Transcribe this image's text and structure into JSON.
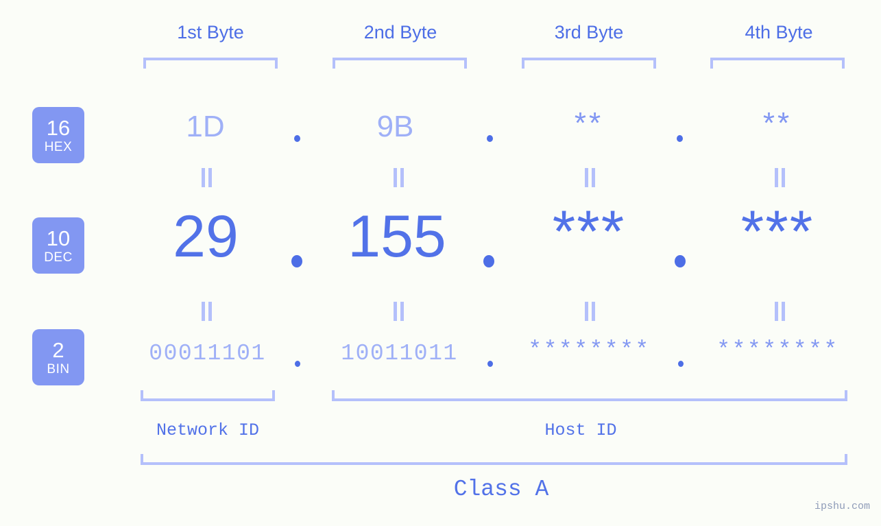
{
  "watermark": "ipshu.com",
  "byte_headers": [
    {
      "label": "1st Byte"
    },
    {
      "label": "2nd Byte"
    },
    {
      "label": "3rd Byte"
    },
    {
      "label": "4th Byte"
    }
  ],
  "radix_badges": [
    {
      "base": "16",
      "name": "HEX"
    },
    {
      "base": "10",
      "name": "DEC"
    },
    {
      "base": "2",
      "name": "BIN"
    }
  ],
  "rows": {
    "hex": {
      "base": "16",
      "name": "HEX",
      "values": [
        "1D",
        "9B",
        "**",
        "**"
      ],
      "separators": [
        ".",
        ".",
        "."
      ]
    },
    "dec": {
      "base": "10",
      "name": "DEC",
      "values": [
        "29",
        "155",
        "***",
        "***"
      ],
      "separators": [
        ".",
        ".",
        "."
      ]
    },
    "bin": {
      "base": "2",
      "name": "BIN",
      "values": [
        "00011101",
        "10011011",
        "********",
        "********"
      ],
      "separators": [
        ".",
        ".",
        "."
      ]
    }
  },
  "sections": {
    "network_id": "Network ID",
    "host_id": "Host ID",
    "class": "Class A"
  },
  "colors": {
    "background": "#fbfdf8",
    "accent_strong": "#4d6ee6",
    "accent_mid": "#5272e8",
    "accent_badge": "#8297f2",
    "accent_light": "#9fb0f7",
    "bracket": "#b4c0fb",
    "badge_text": "#ffffff",
    "watermark": "#8e9bb8"
  }
}
